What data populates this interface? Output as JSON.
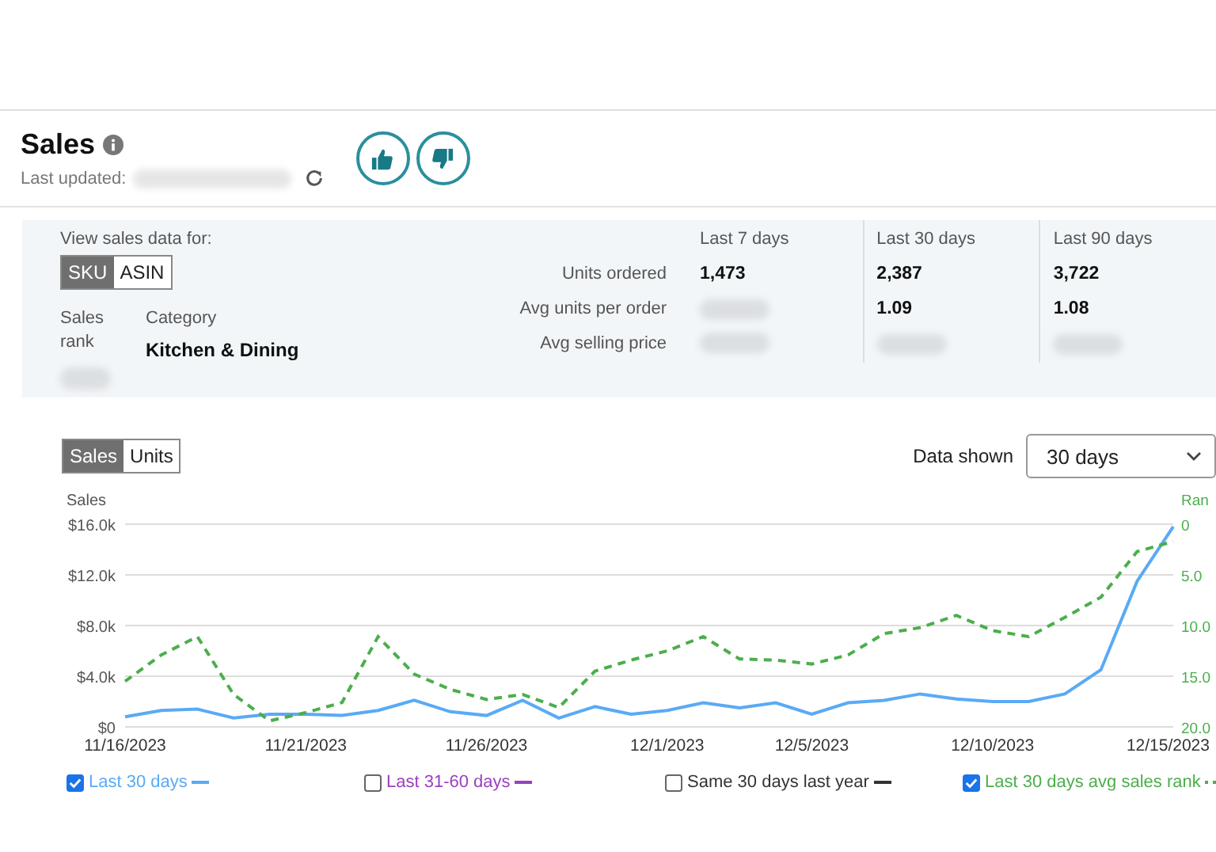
{
  "header": {
    "title": "Sales",
    "last_updated_label": "Last updated:"
  },
  "summary": {
    "view_label": "View sales data for:",
    "view_toggle": [
      {
        "label": "SKU",
        "selected": true
      },
      {
        "label": "ASIN",
        "selected": false
      }
    ],
    "sales_rank_label": "Sales rank",
    "category_label": "Category",
    "category_value": "Kitchen & Dining",
    "metric_labels": [
      "Units ordered",
      "Avg units per order",
      "Avg selling price"
    ],
    "periods": [
      {
        "header": "Last 7 days",
        "values": [
          "1,473"
        ]
      },
      {
        "header": "Last 30 days",
        "values": [
          "2,387",
          "1.09"
        ]
      },
      {
        "header": "Last 90 days",
        "values": [
          "3,722",
          "1.08"
        ]
      }
    ]
  },
  "chart_section": {
    "mode_toggle": [
      {
        "label": "Sales",
        "selected": true
      },
      {
        "label": "Units",
        "selected": false
      }
    ],
    "data_shown_label": "Data shown",
    "data_shown_value": "30 days",
    "chart_data": {
      "type": "line",
      "ylabel": "Sales",
      "y2label": "Ran",
      "categories": [
        "11/16/2023",
        null,
        null,
        null,
        null,
        "11/21/2023",
        null,
        null,
        null,
        null,
        "11/26/2023",
        null,
        null,
        null,
        null,
        "12/1/2023",
        null,
        null,
        null,
        "12/5/2023",
        null,
        null,
        null,
        null,
        "12/10/2023",
        null,
        null,
        null,
        null,
        "12/15/2023"
      ],
      "ylim": [
        0,
        16000
      ],
      "yticks": [
        {
          "value": 0,
          "label": "$0"
        },
        {
          "value": 4000,
          "label": "$4.0k"
        },
        {
          "value": 8000,
          "label": "$8.0k"
        },
        {
          "value": 12000,
          "label": "$12.0k"
        },
        {
          "value": 16000,
          "label": "$16.0k"
        }
      ],
      "grid": true,
      "y2lim": [
        20,
        0
      ],
      "y2ticks": [
        {
          "value": 0,
          "label": "0"
        },
        {
          "value": 5,
          "label": "5.0"
        },
        {
          "value": 10,
          "label": "10.0"
        },
        {
          "value": 15,
          "label": "15.0"
        },
        {
          "value": 20,
          "label": "20.0"
        }
      ],
      "series": [
        {
          "name": "Last 30 days",
          "color": "#5aaaf5",
          "line_style": "solid",
          "values": [
            800,
            1300,
            1400,
            700,
            1000,
            1000,
            900,
            1300,
            2100,
            1200,
            900,
            2100,
            700,
            1600,
            1000,
            1300,
            1900,
            1500,
            1900,
            1000,
            1900,
            2100,
            2600,
            2200,
            2000,
            2000,
            2600,
            4500,
            11500,
            15800
          ]
        },
        {
          "name": "Last 30 days avg sales rank",
          "color": "#4cae4c",
          "axis": "y2",
          "line_style": "dashed",
          "values": [
            15.5,
            12.9,
            11.1,
            16.8,
            19.4,
            18.6,
            17.6,
            11.1,
            14.8,
            16.3,
            17.3,
            16.8,
            18.1,
            14.5,
            13.4,
            12.5,
            11.1,
            13.3,
            13.4,
            13.8,
            12.9,
            10.8,
            10.2,
            9.0,
            10.5,
            11.1,
            9.2,
            7.2,
            2.7,
            1.7
          ]
        }
      ]
    }
  },
  "legend": [
    {
      "kind": "series",
      "checked": true
    },
    {
      "label": "Last 31-60 days",
      "checked": false,
      "color": "#9b3fbf",
      "kind": "solid"
    },
    {
      "label": "Same 30 days last year",
      "checked": false,
      "color": "#333333",
      "kind": "solid"
    },
    {
      "kind": "series",
      "checked": true
    }
  ]
}
